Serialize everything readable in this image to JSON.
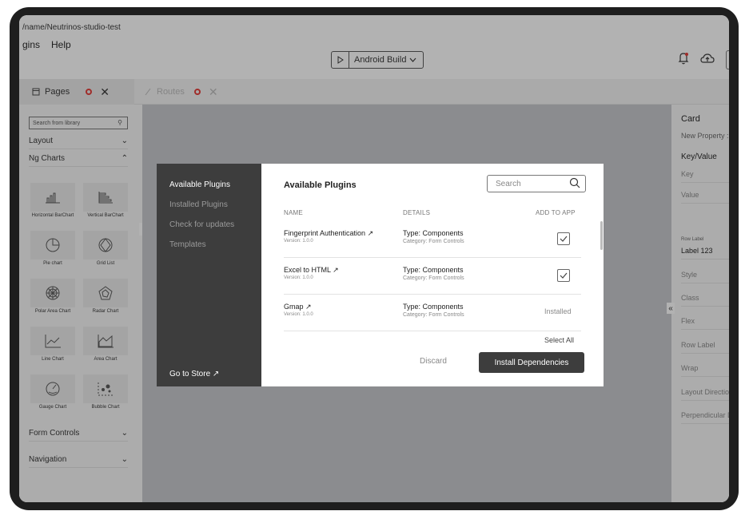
{
  "header": {
    "path": "/name/Neutrinos-studio-test",
    "menu": [
      "gins",
      "Help"
    ],
    "build_label": "Android Build"
  },
  "tabs": [
    {
      "label": "Pages"
    },
    {
      "label": "Routes"
    }
  ],
  "library": {
    "search_placeholder": "Search from library",
    "sections": {
      "layout": "Layout",
      "ng_charts": "Ng Charts",
      "form_controls": "Form Controls",
      "navigation": "Navigation"
    },
    "items": [
      {
        "label": "Horizontal BarChart",
        "icon": "horizontal-bar-chart-icon"
      },
      {
        "label": "Vertical BarChart",
        "icon": "vertical-bar-chart-icon"
      },
      {
        "label": "Pie chart",
        "icon": "pie-chart-icon"
      },
      {
        "label": "Grid List",
        "icon": "grid-list-icon"
      },
      {
        "label": "Polar Area Chart",
        "icon": "polar-area-chart-icon"
      },
      {
        "label": "Radar Chart",
        "icon": "radar-chart-icon"
      },
      {
        "label": "Line Chart",
        "icon": "line-chart-icon"
      },
      {
        "label": "Area Chart",
        "icon": "area-chart-icon"
      },
      {
        "label": "Gauge Chart",
        "icon": "gauge-chart-icon"
      },
      {
        "label": "Bubble Chart",
        "icon": "bubble-chart-icon"
      }
    ]
  },
  "properties": {
    "title": "Card",
    "new_property": "New Property : A",
    "key_value": "Key/Value",
    "key": "Key",
    "value": "Value",
    "row_label_caption": "Row Label",
    "row_label_value": "Label 123",
    "fields": [
      "Style",
      "Class",
      "Flex",
      "Row Label",
      "Wrap",
      "Layout Direction",
      "Perpendicular D"
    ]
  },
  "modal": {
    "nav": [
      "Available Plugins",
      "Installed Plugins",
      "Check for updates",
      "Templates"
    ],
    "store": "Go to Store ↗",
    "title": "Available Plugins",
    "search_placeholder": "Search",
    "columns": {
      "name": "NAME",
      "details": "DETAILS",
      "add": "ADD TO APP"
    },
    "plugins": [
      {
        "name": "Fingerprint Authentication ↗",
        "version": "Version: 1.0.0",
        "type": "Type: Components",
        "category": "Category: Form Controls",
        "status": "checked"
      },
      {
        "name": "Excel to HTML ↗",
        "version": "Version: 1.0.0",
        "type": "Type: Components",
        "category": "Category: Form Controls",
        "status": "checked"
      },
      {
        "name": "Gmap ↗",
        "version": "Version: 1.0.0",
        "type": "Type: Components",
        "category": "Category: Form Controls",
        "status": "Installed"
      }
    ],
    "select_all": "Select All",
    "discard": "Discard",
    "install": "Install Dependencies"
  },
  "colors": {
    "modal_sidebar": "#3d3d3d",
    "canvas": "#c5c7cb",
    "notification": "#e53935"
  }
}
